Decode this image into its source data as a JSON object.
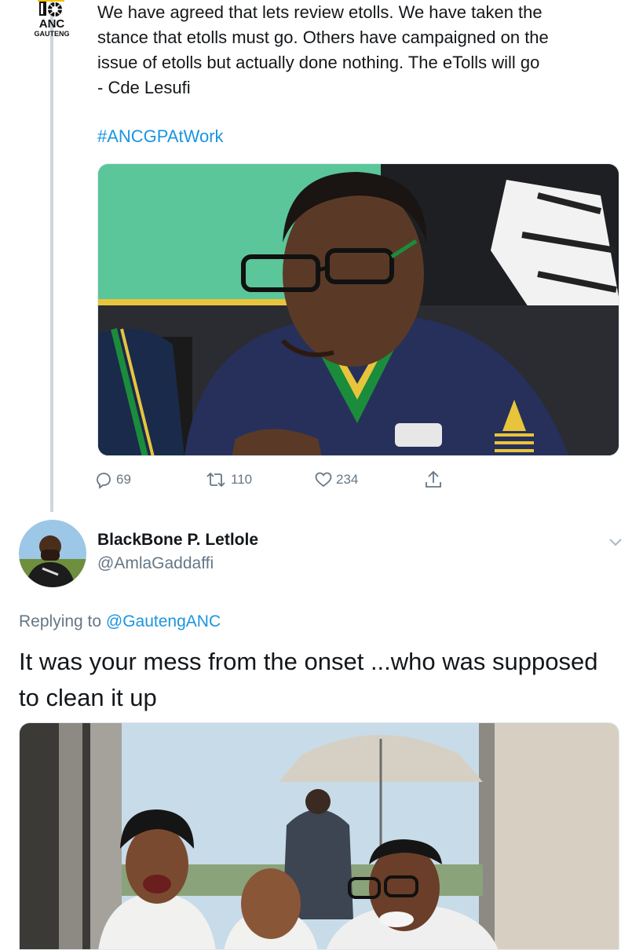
{
  "tweet": {
    "author_logo": {
      "line1": "ANC",
      "line2": "GAUTENG"
    },
    "text": "We have agreed that lets review etolls. We have taken the\nstance that etolls must go. Others have campaigned on the\nissue of etolls but actually done nothing. The eTolls will go\n- Cde Lesufi",
    "hashtag": "#ANCGPAtWork",
    "actions": {
      "replies": "69",
      "retweets": "110",
      "likes": "234"
    },
    "colors": {
      "link": "#1b95e0",
      "action": "#657786",
      "thread_line": "#ccd6dd"
    }
  },
  "reply": {
    "display_name": "BlackBone P. Letlole",
    "handle": "@AmlaGaddaffi",
    "replying_prefix": "Replying to",
    "replying_to": "@GautengANC",
    "text": "It was your mess from the onset ...who was supposed to clean it up"
  },
  "icons": {
    "reply": "reply-icon",
    "retweet": "retweet-icon",
    "like": "heart-icon",
    "share": "share-icon",
    "more": "chevron-down-icon"
  }
}
